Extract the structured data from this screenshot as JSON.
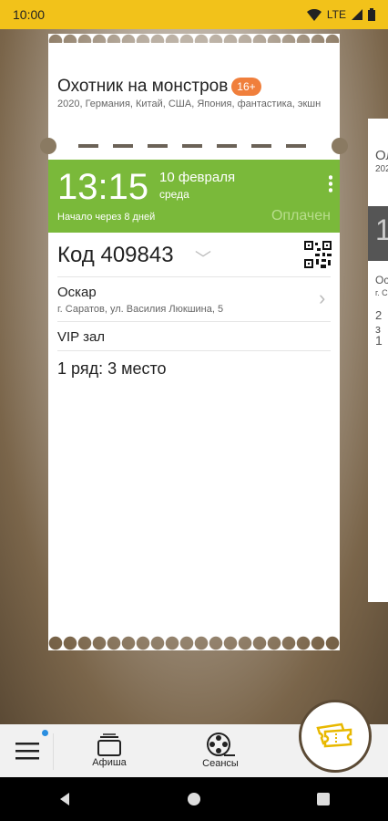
{
  "status_bar": {
    "time": "10:00",
    "network": "LTE"
  },
  "movie": {
    "title": "Охотник на монстров",
    "age_rating": "16+",
    "info": "2020, Германия, Китай, США, Япония, фантастика, экшн"
  },
  "session": {
    "time": "13:15",
    "date": "10 февраля",
    "weekday": "среда",
    "starts_in": "Начало через 8 дней",
    "status": "Оплачен"
  },
  "ticket": {
    "code": "Код 409843",
    "cinema": "Оскар",
    "address": "г. Саратов, ул. Василия Люкшина, 5",
    "hall": "VIP зал",
    "seat": "1 ряд: 3 место"
  },
  "side_ticket": {
    "title_fragment": "Ол",
    "info_fragment": "202",
    "big": "1",
    "cinema_fragment": "Оск",
    "address_fragment": "г. С",
    "extra1": "2 з",
    "extra2": "1"
  },
  "bottom_nav": {
    "afisha": "Афиша",
    "sessions": "Сеансы"
  },
  "colors": {
    "accent": "#7ab93a",
    "status_bar": "#f2c21a",
    "age_badge": "#f07f3c"
  }
}
